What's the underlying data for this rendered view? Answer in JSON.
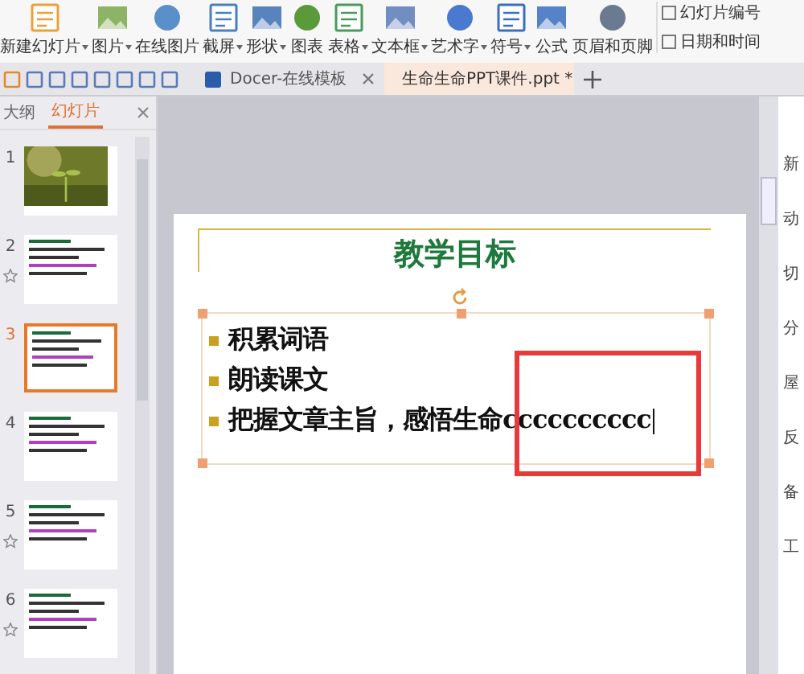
{
  "ribbon": {
    "buttons": [
      {
        "label": "新建幻灯片",
        "dropdown": true
      },
      {
        "label": "图片",
        "dropdown": true
      },
      {
        "label": "在线图片",
        "dropdown": false
      },
      {
        "label": "截屏",
        "dropdown": true
      },
      {
        "label": "形状",
        "dropdown": true
      },
      {
        "label": "图表",
        "dropdown": false
      },
      {
        "label": "表格",
        "dropdown": true
      },
      {
        "label": "文本框",
        "dropdown": true
      },
      {
        "label": "艺术字",
        "dropdown": true
      },
      {
        "label": "符号",
        "dropdown": true
      },
      {
        "label": "公式",
        "dropdown": false
      },
      {
        "label": "页眉和页脚",
        "dropdown": false
      }
    ],
    "side_buttons": [
      {
        "label": "幻灯片编号"
      },
      {
        "label": "日期和时间"
      }
    ]
  },
  "doc_tabs": [
    {
      "label": "Docer-在线模板",
      "selected": false
    },
    {
      "label": "生命生命PPT课件.ppt *",
      "selected": true
    }
  ],
  "panel_tabs": [
    {
      "label": "大纲",
      "selected": false
    },
    {
      "label": "幻灯片",
      "selected": true
    }
  ],
  "slides": [
    {
      "number": "1",
      "starred": false,
      "selected": false
    },
    {
      "number": "2",
      "starred": true,
      "selected": false,
      "kind": "text"
    },
    {
      "number": "3",
      "starred": false,
      "selected": true,
      "kind": "text"
    },
    {
      "number": "4",
      "starred": false,
      "selected": false,
      "kind": "text"
    },
    {
      "number": "5",
      "starred": true,
      "selected": false,
      "kind": "text"
    },
    {
      "number": "6",
      "starred": true,
      "selected": false,
      "kind": "text"
    }
  ],
  "slide": {
    "title": "教学目标",
    "bullets": [
      "积累词语",
      "朗读课文",
      "把握文章主旨，感悟生命cccccccccc"
    ]
  },
  "right_panel": [
    "新",
    "动",
    "切",
    "分",
    "屋",
    "反",
    "备",
    "工"
  ]
}
